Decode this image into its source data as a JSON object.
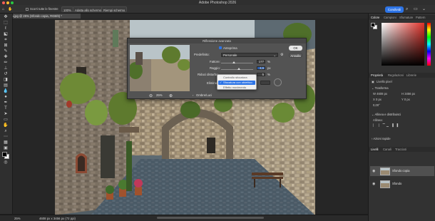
{
  "window": {
    "title": "Adobe Photoshop 2026",
    "traffic_colors": [
      "#ff5f57",
      "#febc2e",
      "#28c840"
    ]
  },
  "options_bar": {
    "items": [
      {
        "type": "checkbox",
        "label": "Scorri tutte le finestre"
      },
      {
        "type": "button",
        "label": "100%"
      },
      {
        "type": "button",
        "label": "Adatta allo schermo"
      },
      {
        "type": "button",
        "label": "Riempi schermo"
      }
    ],
    "share_label": "Condividi",
    "accent": "#2d74e6"
  },
  "document": {
    "tab_label": "Bfonza.jpg @ 25% (Sfondo copia, RGB/8) *"
  },
  "status": {
    "zoom": "25%",
    "info": "4608 px x 3456 px (72 ppi)"
  },
  "dialog": {
    "title": "Riflessione avanzata",
    "preview_label": "Anteprima",
    "preset_label": "Predefinito:",
    "preset_value": "Personale",
    "ok_label": "OK",
    "cancel_label": "Annulla",
    "sliders": [
      {
        "label": "Fattore:",
        "value": "177",
        "unit": "%",
        "fraction": 0.4
      },
      {
        "label": "Raggio:",
        "value": "3,6",
        "unit": "px",
        "fraction": 0.55
      },
      {
        "label": "Riduci disturbo:",
        "value": "5",
        "unit": "%",
        "fraction": 0.05
      }
    ],
    "remove_label": "Elimina:",
    "preview_zoom": "25%",
    "section_label": "Ombre/Luci",
    "dropdown": {
      "options": [
        "Controllo sfocatura",
        "Sfocatura con obiettivo",
        "Effetto movimento"
      ],
      "selected": "Sfocatura con obiettivo"
    }
  },
  "right_panel": {
    "top_tabs": [
      "Colore",
      "Campioni",
      "Sfumature",
      "Pattern"
    ],
    "mid_tabs": [
      "Proprietà",
      "Regolazioni",
      "Librerie"
    ],
    "pixel_layer": "Livello pixel",
    "transform_label": "Trasforma",
    "transform_values": [
      "W 4608 px",
      "H 3456 px",
      "X 0 px",
      "Y 0 px",
      "0,00°"
    ],
    "align_label": "Allinea e distribuisci",
    "align_sub": "Allinea:",
    "actions_label": "Azioni rapide",
    "layer_tabs": [
      "Livelli",
      "Canali",
      "Tracciati"
    ],
    "layers": [
      {
        "name": "Sfondo copia",
        "selected": true
      },
      {
        "name": "Sfondo",
        "selected": false
      }
    ]
  }
}
